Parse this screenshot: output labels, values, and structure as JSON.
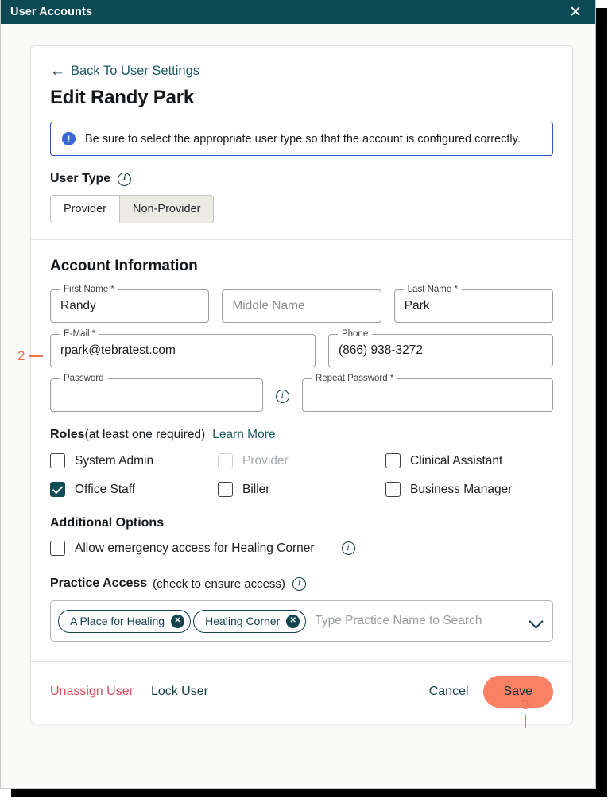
{
  "window": {
    "title": "User Accounts",
    "close_label": "✕"
  },
  "header": {
    "back_link": "Back To User Settings",
    "back_arrow": "←",
    "page_title": "Edit Randy Park"
  },
  "banner": {
    "icon_glyph": "!",
    "text": "Be sure to select the appropriate user type so that the account is configured correctly."
  },
  "user_type": {
    "label": "User Type",
    "info_glyph": "i",
    "options": [
      {
        "label": "Provider",
        "selected": false
      },
      {
        "label": "Non-Provider",
        "selected": true
      }
    ]
  },
  "account_information": {
    "title": "Account Information",
    "fields": {
      "first_name": {
        "label": "First Name *",
        "value": "Randy",
        "placeholder": ""
      },
      "middle_name": {
        "label": "",
        "value": "",
        "placeholder": "Middle Name"
      },
      "last_name": {
        "label": "Last Name *",
        "value": "Park",
        "placeholder": ""
      },
      "email": {
        "label": "E-Mail *",
        "value": "rpark@tebratest.com",
        "placeholder": ""
      },
      "phone": {
        "label": "Phone",
        "value": "(866) 938-3272",
        "placeholder": ""
      },
      "password": {
        "label": "Password",
        "value": "",
        "placeholder": ""
      },
      "repeat_password": {
        "label": "Repeat Password *",
        "value": "",
        "placeholder": ""
      }
    }
  },
  "roles": {
    "title": "Roles",
    "hint": "(at least one required)",
    "learn_more": "Learn More",
    "items": [
      {
        "label": "System Admin",
        "checked": false,
        "disabled": false
      },
      {
        "label": "Provider",
        "checked": false,
        "disabled": true
      },
      {
        "label": "Clinical Assistant",
        "checked": false,
        "disabled": false
      },
      {
        "label": "Office Staff",
        "checked": true,
        "disabled": false
      },
      {
        "label": "Biller",
        "checked": false,
        "disabled": false
      },
      {
        "label": "Business Manager",
        "checked": false,
        "disabled": false
      }
    ]
  },
  "additional_options": {
    "title": "Additional Options",
    "emergency_access": {
      "label": "Allow emergency access for Healing Corner",
      "checked": false
    }
  },
  "practice_access": {
    "title": "Practice Access",
    "hint": "(check to ensure access)",
    "chips": [
      {
        "label": "A Place for Healing",
        "remove_glyph": "✕"
      },
      {
        "label": "Healing Corner",
        "remove_glyph": "✕"
      }
    ],
    "search_placeholder": "Type Practice Name to Search"
  },
  "footer": {
    "unassign_user": "Unassign User",
    "lock_user": "Lock User",
    "cancel": "Cancel",
    "save": "Save"
  },
  "annotations": [
    {
      "number": "2",
      "target": "email-field"
    },
    {
      "number": "3",
      "target": "save-button"
    }
  ],
  "colors": {
    "titlebar": "#0b4a55",
    "accent_teal": "#15414b",
    "banner_blue": "#2f56c4",
    "danger_red": "#e04a58",
    "save_coral": "#fa8164",
    "annotation_orange": "#f2704c"
  }
}
